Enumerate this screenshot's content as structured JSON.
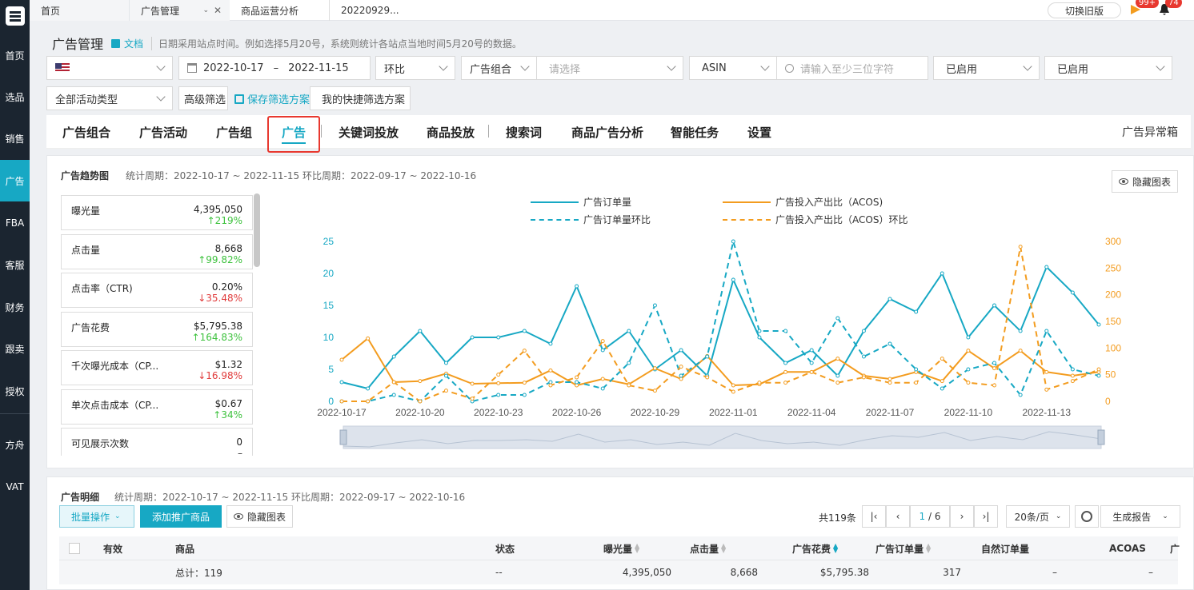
{
  "sidebar": {
    "items": [
      "首页",
      "选品",
      "销售",
      "广告",
      "FBA",
      "客服",
      "财务",
      "跟卖",
      "授权",
      "方舟",
      "VAT"
    ],
    "active": "广告"
  },
  "topbar": {
    "tabs": {
      "home": "首页",
      "ad": "广告管理",
      "ops": "商品运营分析",
      "date": "20220929..."
    },
    "switch_label": "切换旧版",
    "badge1": "99+",
    "badge2": "74"
  },
  "header": {
    "title": "广告管理",
    "doc_link": "文档",
    "hint": "日期采用站点时间。例如选择5月20号，系统则统计各站点当地时间5月20号的数据。"
  },
  "filters": {
    "date_start": "2022-10-17",
    "date_sep": "–",
    "date_end": "2022-11-15",
    "compare": "环比",
    "portfolio": "广告组合",
    "portfolio_placeholder": "请选择",
    "asin": "ASIN",
    "asin_placeholder": "请输入至少三位字符",
    "status1": "已启用",
    "status2": "已启用",
    "activity_type": "全部活动类型",
    "advanced": "高级筛选",
    "save_scheme": "保存筛选方案",
    "my_schemes": "我的快捷筛选方案"
  },
  "tabs": {
    "items": [
      "广告组合",
      "广告活动",
      "广告组",
      "广告",
      "关键词投放",
      "商品投放",
      "搜索词",
      "商品广告分析",
      "智能任务",
      "设置"
    ],
    "active": "广告",
    "right": "广告异常箱"
  },
  "trend": {
    "title": "广告趋势图",
    "period": "统计周期：2022-10-17 ~ 2022-11-15 环比周期：2022-09-17 ~ 2022-10-16",
    "hide_label": "隐藏图表"
  },
  "metrics": [
    {
      "name": "曝光量",
      "value": "4,395,050",
      "change": "↑219%",
      "dir": "up"
    },
    {
      "name": "点击量",
      "value": "8,668",
      "change": "↑99.82%",
      "dir": "up"
    },
    {
      "name": "点击率（CTR)",
      "value": "0.20%",
      "change": "↓35.48%",
      "dir": "down"
    },
    {
      "name": "广告花费",
      "value": "$5,795.38",
      "change": "↑164.83%",
      "dir": "up"
    },
    {
      "name": "千次曝光成本（CP...",
      "value": "$1.32",
      "change": "↓16.98%",
      "dir": "down"
    },
    {
      "name": "单次点击成本（CP...",
      "value": "$0.67",
      "change": "↑34%",
      "dir": "up"
    },
    {
      "name": "可见展示次数",
      "value": "0",
      "change": "–",
      "dir": "none"
    }
  ],
  "chart_data": {
    "type": "line",
    "x": [
      "2022-10-17",
      "2022-10-18",
      "2022-10-19",
      "2022-10-20",
      "2022-10-21",
      "2022-10-22",
      "2022-10-23",
      "2022-10-24",
      "2022-10-25",
      "2022-10-26",
      "2022-10-27",
      "2022-10-28",
      "2022-10-29",
      "2022-10-30",
      "2022-10-31",
      "2022-11-01",
      "2022-11-02",
      "2022-11-03",
      "2022-11-04",
      "2022-11-05",
      "2022-11-06",
      "2022-11-07",
      "2022-11-08",
      "2022-11-09",
      "2022-11-10",
      "2022-11-11",
      "2022-11-12",
      "2022-11-13",
      "2022-11-14",
      "2022-11-15"
    ],
    "xticks": [
      "2022-10-17",
      "2022-10-20",
      "2022-10-23",
      "2022-10-26",
      "2022-10-29",
      "2022-11-01",
      "2022-11-04",
      "2022-11-07",
      "2022-11-10",
      "2022-11-13"
    ],
    "y_left": {
      "ticks": [
        0,
        5,
        10,
        15,
        20,
        25
      ],
      "range": [
        0,
        25
      ],
      "color": "#17a8c4"
    },
    "y_right": {
      "ticks": [
        0,
        50,
        100,
        150,
        200,
        250,
        300
      ],
      "range": [
        0,
        300
      ],
      "color": "#f39c1f"
    },
    "series": [
      {
        "name": "广告订单量",
        "axis": "left",
        "style": "solid",
        "color": "#17a8c4",
        "values": [
          3,
          2,
          7,
          11,
          6,
          10,
          10,
          11,
          9,
          18,
          8,
          11,
          5,
          8,
          4,
          19,
          10,
          6,
          8,
          4,
          11,
          16,
          14,
          20,
          10,
          15,
          11,
          21,
          17,
          12
        ]
      },
      {
        "name": "广告投入产出比（ACOS)",
        "axis": "right",
        "style": "solid",
        "color": "#f39c1f",
        "values": [
          78,
          118,
          36,
          38,
          52,
          33,
          34,
          35,
          58,
          30,
          42,
          32,
          62,
          42,
          85,
          30,
          32,
          55,
          55,
          80,
          48,
          42,
          55,
          38,
          95,
          62,
          95,
          55,
          48,
          55
        ]
      },
      {
        "name": "广告订单量环比",
        "axis": "left",
        "style": "dashed",
        "color": "#17a8c4",
        "values": [
          0,
          0,
          1,
          0,
          4,
          0,
          1,
          1,
          3,
          3,
          2,
          6,
          15,
          4,
          7,
          25,
          11,
          11,
          6,
          13,
          7,
          9,
          5,
          2,
          5,
          6,
          1,
          11,
          5,
          4
        ]
      },
      {
        "name": "广告投入产出比（ACOS）环比",
        "axis": "right",
        "style": "dashed",
        "color": "#f39c1f",
        "values": [
          0,
          0,
          36,
          0,
          20,
          5,
          50,
          95,
          30,
          45,
          113,
          30,
          20,
          65,
          45,
          18,
          35,
          35,
          55,
          35,
          45,
          35,
          35,
          80,
          35,
          30,
          290,
          22,
          38,
          60
        ]
      }
    ],
    "legend_position": "top-center"
  },
  "detail": {
    "title": "广告明细",
    "period": "统计周期：2022-10-17 ~ 2022-11-15 环比周期：2022-09-17 ~ 2022-10-16",
    "batch": "批量操作",
    "add": "添加推广商品",
    "hide": "隐藏图表",
    "total": "共119条",
    "page_current": "1",
    "page_total": "/ 6",
    "page_size": "20条/页",
    "report": "生成报告"
  },
  "table": {
    "headers": [
      "有效",
      "商品",
      "状态",
      "曝光量",
      "点击量",
      "广告花费",
      "广告订单量",
      "自然订单量",
      "ACOAS",
      "广"
    ],
    "total_row": [
      "",
      "总计：119",
      "--",
      "4,395,050",
      "8,668",
      "$5,795.38",
      "317",
      "–",
      "–"
    ]
  }
}
